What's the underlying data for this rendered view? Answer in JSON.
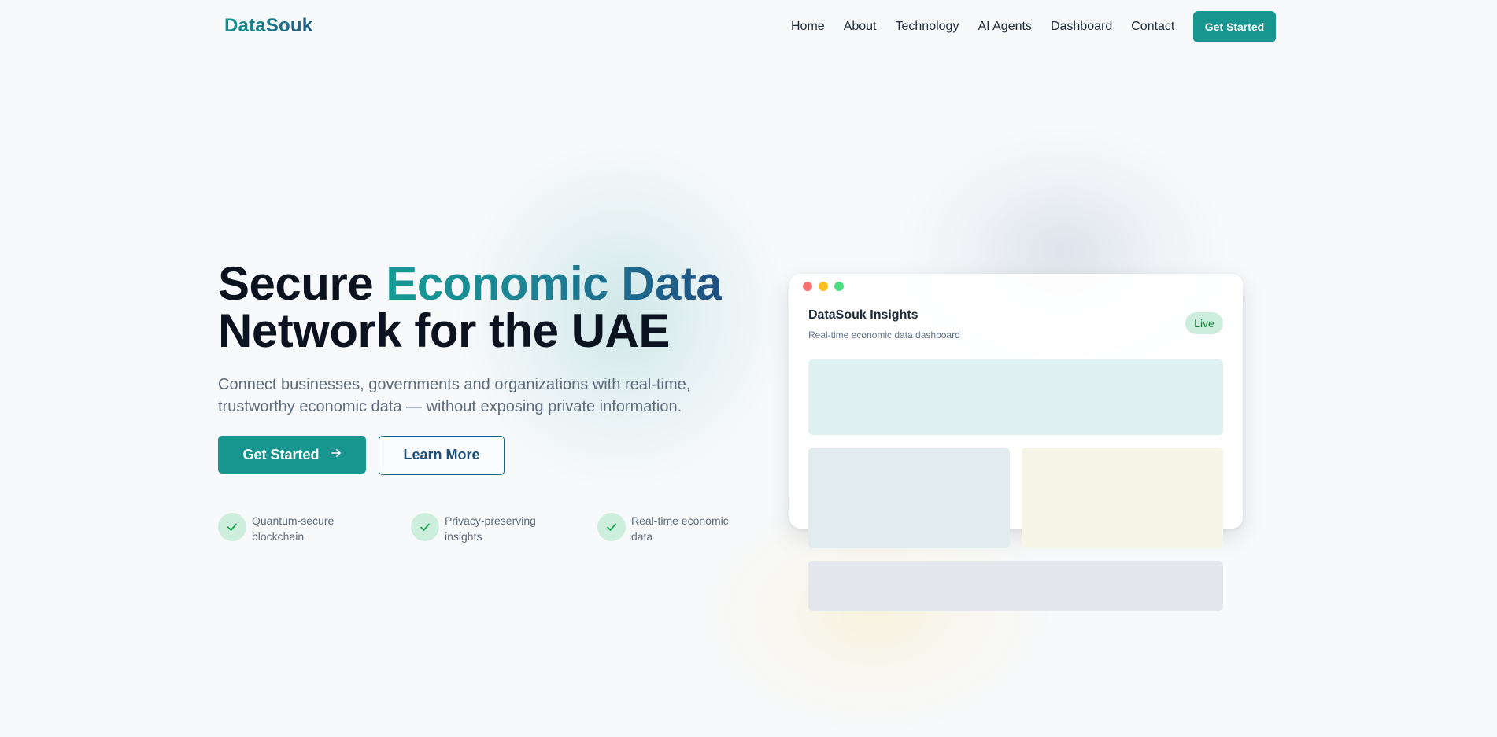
{
  "brand": {
    "name": "DataSouk"
  },
  "nav": {
    "links": [
      "Home",
      "About",
      "Technology",
      "AI Agents",
      "Dashboard",
      "Contact"
    ],
    "cta": "Get Started"
  },
  "hero": {
    "title_line1_plain": "Secure ",
    "title_line1_accent": "Economic Data",
    "title_line2": "Network for the UAE",
    "subtitle_line1": "Connect businesses, governments and organizations with real-time,",
    "subtitle_line2": "trustworthy economic data — without exposing private information.",
    "primary_button": "Get Started",
    "secondary_button": "Learn More",
    "features": [
      {
        "line1": "Quantum-secure",
        "line2": "blockchain"
      },
      {
        "line1": "Privacy-preserving",
        "line2": "insights"
      },
      {
        "line1": "Real-time economic",
        "line2": "data"
      }
    ]
  },
  "dashboard_card": {
    "title": "DataSouk Insights",
    "subtitle": "Real-time economic data dashboard",
    "badge": "Live"
  },
  "colors": {
    "accent": "#17958f",
    "accent_dark": "#1d4f78",
    "window_dot_red": "#f87171",
    "window_dot_yellow": "#fbbf24",
    "window_dot_green": "#4ade80"
  },
  "icons": {
    "check": "check-icon",
    "arrow": "arrow-right-icon"
  }
}
